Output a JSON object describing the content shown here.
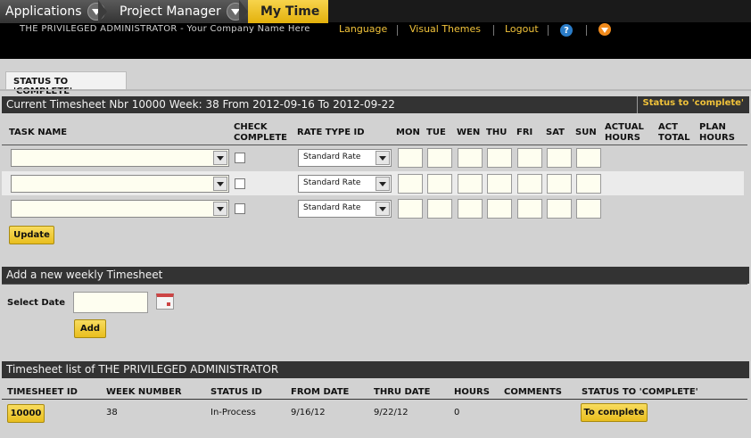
{
  "topnav": {
    "tabs": [
      {
        "label": "Applications"
      },
      {
        "label": "Project Manager"
      },
      {
        "label": "My Time"
      }
    ]
  },
  "userbar": {
    "user": "THE PRIVILEGED ADMINISTRATOR - Your Company Name Here",
    "links": [
      "Language",
      "Visual Themes",
      "Logout"
    ],
    "help_glyph": "?"
  },
  "status_tab": "STATUS TO 'COMPLETE'",
  "timesheet": {
    "title": "Current Timesheet Nbr 10000 Week: 38 From 2012-09-16 To 2012-09-22",
    "badge": "Status to 'complete'",
    "headers": {
      "task": "TASK NAME",
      "check_1": "CHECK",
      "check_2": "COMPLETE",
      "rate": "RATE TYPE ID",
      "days": [
        "MON",
        "TUE",
        "WEN",
        "THU",
        "FRI",
        "SAT",
        "SUN"
      ],
      "actual_1": "ACTUAL",
      "actual_2": "HOURS",
      "act_total_1": "ACT",
      "act_total_2": "TOTAL",
      "plan_1": "PLAN",
      "plan_2": "HOURS"
    },
    "rows": [
      {
        "task": "",
        "rate": "Standard Rate"
      },
      {
        "task": "",
        "rate": "Standard Rate"
      },
      {
        "task": "",
        "rate": "Standard Rate"
      }
    ],
    "update_label": "Update"
  },
  "new_sheet": {
    "title": "Add a new weekly Timesheet",
    "select_date_label": "Select Date",
    "date_value": "",
    "add_label": "Add"
  },
  "list": {
    "title": "Timesheet list of THE PRIVILEGED ADMINISTRATOR",
    "columns": [
      "TIMESHEET ID",
      "WEEK NUMBER",
      "STATUS ID",
      "FROM DATE",
      "THRU DATE",
      "HOURS",
      "COMMENTS",
      "STATUS TO 'COMPLETE'"
    ],
    "rows": [
      {
        "id": "10000",
        "week": "38",
        "status": "In-Process",
        "from": "9/16/12",
        "thru": "9/22/12",
        "hours": "0",
        "comments": "",
        "action": "To complete"
      }
    ]
  },
  "colors": {
    "accent": "#f0c23a",
    "bar": "#333333",
    "panel": "#d2d2d2"
  }
}
